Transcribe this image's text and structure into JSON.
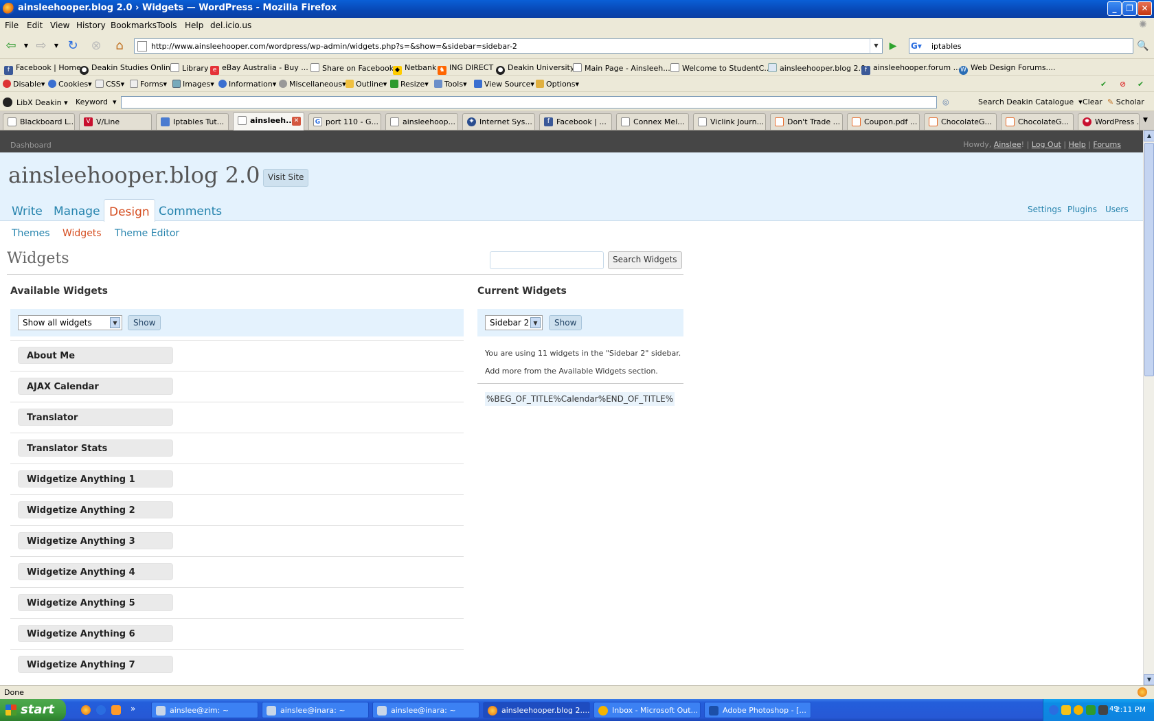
{
  "window": {
    "title": "ainsleehooper.blog 2.0 › Widgets — WordPress - Mozilla Firefox"
  },
  "menu": [
    "File",
    "Edit",
    "View",
    "History",
    "Bookmarks",
    "Tools",
    "Help",
    "del.icio.us"
  ],
  "nav": {
    "url": "http://www.ainsleehooper.com/wordpress/wp-admin/widgets.php?s=&show=&sidebar=sidebar-2",
    "search_value": "iptables"
  },
  "bookmarks": [
    "Facebook | Home",
    "Deakin Studies Online",
    "Library",
    "eBay Australia - Buy ...",
    "Share on Facebook",
    "Netbank",
    "ING DIRECT",
    "Deakin University",
    "Main Page - Ainsleeh...",
    "Welcome to StudentC...",
    "ainsleehooper.blog 2.0",
    "ainsleehooper.forum ...",
    "Web Design Forums...."
  ],
  "webdev": [
    "Disable",
    "Cookies",
    "CSS",
    "Forms",
    "Images",
    "Information",
    "Miscellaneous",
    "Outline",
    "Resize",
    "Tools",
    "View Source",
    "Options"
  ],
  "libx": {
    "name": "LibX Deakin",
    "keyword": "Keyword",
    "search_catalogue": "Search Deakin Catalogue",
    "clear": "Clear",
    "scholar": "Scholar"
  },
  "tabs": [
    "Blackboard L...",
    "V/Line",
    "Iptables Tut...",
    "ainsleeh...",
    "port 110 - G...",
    "ainsleehoop...",
    "Internet Sys...",
    "Facebook | ...",
    "Connex Mel...",
    "Viclink Journ...",
    "Don't Trade ...",
    "Coupon.pdf ...",
    "ChocolateG...",
    "ChocolateG...",
    "WordPress ..."
  ],
  "wp": {
    "dashboard": "Dashboard",
    "howdy": "Howdy,",
    "user": "Ainslee",
    "exclaim": "!",
    "sep": "|",
    "logout": "Log Out",
    "help": "Help",
    "forums": "Forums",
    "blog_title": "ainsleehooper.blog 2.0",
    "visit_site": "Visit Site",
    "main_tabs": [
      "Write",
      "Manage",
      "Design",
      "Comments"
    ],
    "right_links": [
      "Settings",
      "Plugins",
      "Users"
    ],
    "sub_tabs": [
      "Themes",
      "Widgets",
      "Theme Editor"
    ],
    "page_title": "Widgets",
    "search_button": "Search Widgets",
    "available_heading": "Available Widgets",
    "available_select": "Show all widgets",
    "show_label": "Show",
    "widgets": [
      "About Me",
      "AJAX Calendar",
      "Translator",
      "Translator Stats",
      "Widgetize Anything 1",
      "Widgetize Anything 2",
      "Widgetize Anything 3",
      "Widgetize Anything 4",
      "Widgetize Anything 5",
      "Widgetize Anything 6",
      "Widgetize Anything 7"
    ],
    "current_heading": "Current Widgets",
    "current_select": "Sidebar 2",
    "info_line1": "You are using 11 widgets in the \"Sidebar 2\" sidebar.",
    "info_line2": "Add more from the Available Widgets section.",
    "current_widget": "%BEG_OF_TITLE%Calendar%END_OF_TITLE%"
  },
  "status": "Done",
  "taskbar": {
    "start": "start",
    "items": [
      "ainslee@zim: ~",
      "ainslee@inara: ~",
      "ainslee@inara: ~",
      "ainsleehooper.blog 2....",
      "Inbox - Microsoft Out...",
      "Adobe Photoshop - [..."
    ],
    "clock": "2:11 PM",
    "tray_badge": "49"
  }
}
